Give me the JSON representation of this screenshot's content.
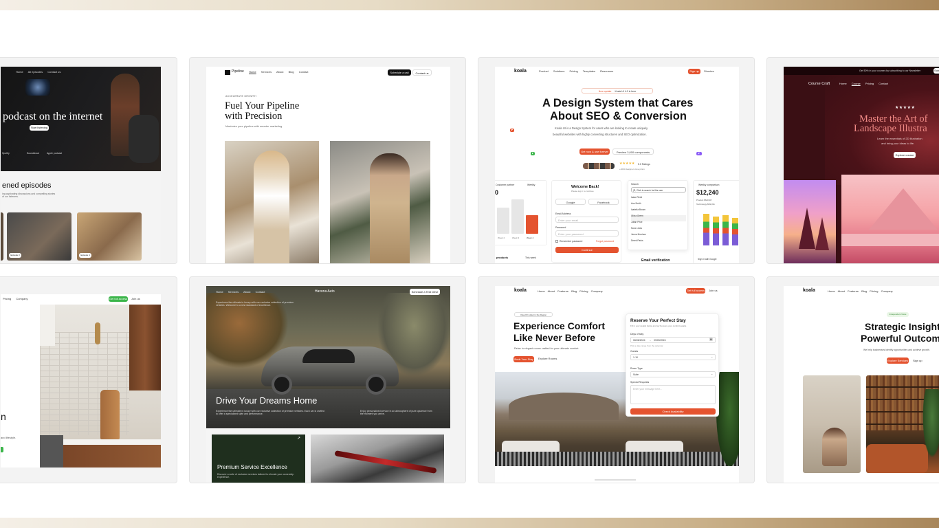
{
  "colors": {
    "accent_orange": "#e4532f",
    "green": "#3bb54a",
    "dark_green": "#1f2f1e",
    "maroon": "#3a0f14",
    "pink": "#f08a86"
  },
  "cards": {
    "podcast": {
      "nav": [
        "Home",
        "All episodes",
        "Contact us"
      ],
      "hero_text": "podcast on the internet",
      "cta": "Start listening",
      "platforms": [
        "Spotify",
        "Soundcloud",
        "Apple podcast"
      ],
      "section_title": "ened episodes",
      "section_desc": "ing captivating discussions and compelling stories\nof our listeners.",
      "ep_labels": [
        "Episode 3",
        "Episode 4"
      ]
    },
    "pipeline": {
      "logo": "Pipeline",
      "nav": [
        "Home",
        "Services",
        "About",
        "Blog",
        "Contact"
      ],
      "cta_dark": "Schedule a call",
      "cta_light": "Contact us",
      "eyebrow": "ACCELERATE GROWTH",
      "title_line1": "Fuel Your Pipeline",
      "title_line2": "with Precision",
      "subtitle": "Maximize your pipeline with smarter marketing"
    },
    "koala_ds": {
      "logo": "koala",
      "nav": [
        "Product",
        "Solutions",
        "Pricing",
        "Templates",
        "Resources"
      ],
      "signup": "Sign up",
      "signin": "Shoutes",
      "badge_new": "New update",
      "badge_text": "Koala UI 4.0 is here",
      "title_line1": "A Design System that Cares",
      "title_line2": "About SEO & Conversion",
      "desc_line1": "Koala UI is a Design System for users who are looking to create uniquely",
      "desc_line2": "beautiful websites with highly converting structures and SEO optimization.",
      "btn_primary": "Get now & use forever",
      "btn_secondary": "Preview 3,000 components",
      "rating_text": "5.0 Ratings",
      "rating_sub": "+4000 designers love prism",
      "chart_title": "Customer partner",
      "chart_period": "Weekly",
      "chart_value": "0",
      "bar_labels": [
        "Week 2",
        "Week 3",
        "Week 4"
      ],
      "bar_values": [
        40,
        52,
        34
      ],
      "login_title": "Welcome Back!",
      "login_sub": "Please log in to continue",
      "google": "Google",
      "facebook": "Facebook",
      "email_label": "Email Address",
      "email_ph": "Enter your email",
      "password_label": "Password",
      "password_ph": "Enter your password",
      "remember": "Remember password",
      "forgot": "Forgot password",
      "continue": "Continue",
      "search_label": "Search",
      "search_value": "|R, Click to search for this user",
      "people": [
        "Isaac Reed",
        "Ava Smith",
        "Isabella Brown",
        "Olivia Green",
        "Julian Price",
        "Nora Lewis",
        "Jenna Morrison",
        "Derek Parks"
      ],
      "weekly_title": "Weekly comparison",
      "weekly_value": "$12,240",
      "weekly_stats": [
        "Product  $640,38",
        "Technology  $99,031"
      ],
      "email_verif": "Email verification",
      "signin_google": "Sign in with Google",
      "products": "products",
      "this_week": "This week"
    },
    "coursecraft": {
      "banner": "Get 50% in your courses by subscribing to our Newsletter",
      "banner_btn": "Subscribe",
      "logo": "Course Craft",
      "nav": [
        "Home",
        "Course",
        "Pricing",
        "Contact"
      ],
      "stars": "★★★★★",
      "title_line1": "Master the Art of",
      "title_line2": "Landscape Illustra",
      "desc_line1": "Learn the essentials of 2D illustration",
      "desc_line2": "and bring your ideas to life.",
      "cta": "Explore course"
    },
    "interior": {
      "nav": [
        "Pricing",
        "Company"
      ],
      "btn_green": "Get full access",
      "btn_link": "Join us",
      "letter": "n",
      "desc": "and lifestyle."
    },
    "cars": {
      "nav": [
        "Home",
        "Services",
        "About",
        "Contact"
      ],
      "logo": "Havona Auto",
      "cta": "Schedule a Test Drive",
      "intro": "Experience the ultimate in luxury with our exclusive collection of premium vehicles. Welcome to a new standard of excellence.",
      "title": "Drive Your Dreams Home",
      "desc_left": "Experience the ultimate in luxury with our exclusive collection of premium vehicles. Each car is crafted to offer a specialized style and performance.",
      "desc_right": "Enjoy personalized service in an atmosphere of pure opulence from the moment you arrive.",
      "panel_title": "Premium Service Excellence",
      "panel_desc": "Discover a suite of exclusive services tailored to elevate your ownership experience."
    },
    "koala_stay": {
      "logo": "koala",
      "nav": [
        "Home",
        "About",
        "Features",
        "Blog",
        "Pricing",
        "Company"
      ],
      "cta": "Get full access",
      "link": "Join us",
      "badge": "Voted #1 Hotel in the Region",
      "title_line1": "Experience Comfort",
      "title_line2": "Like Never Before",
      "desc": "Relax in elegant rooms crafted for your ultimate comfort.",
      "btn_primary": "Book Your Stay",
      "btn_secondary": "Explore Rooms",
      "form_title": "Reserve Your Perfect Stay",
      "form_sub": "Fill in your details below and we'll ensure your comfort awaits.",
      "dates_label": "Days of stay",
      "date_from": "06/06/2024",
      "date_to": "09/09/2024",
      "dates_hint": "Pick a date range from the calendar",
      "guests_label": "Guests",
      "guests_value": "1-10",
      "room_label": "Room Type",
      "room_value": "Suite",
      "requests_label": "Special Requests",
      "requests_ph": "Enter your message here...",
      "submit": "Check Availability"
    },
    "strategic": {
      "logo": "koala",
      "nav": [
        "Home",
        "About",
        "Features",
        "Blog",
        "Pricing",
        "Company"
      ],
      "badge": "Independent Voice",
      "title_line1": "Strategic Insights",
      "title_line2": "Powerful Outcome",
      "desc": "We help businesses identify opportunities and achieve growth.",
      "btn_primary": "Explore Services",
      "btn_secondary": "Sign up"
    }
  }
}
